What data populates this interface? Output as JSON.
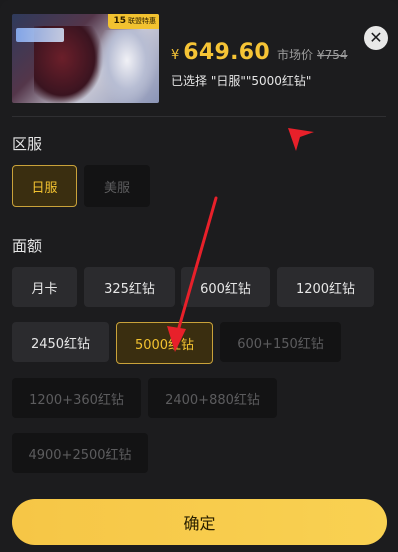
{
  "product": {
    "badge_number": "15",
    "badge_sub": "联盟特惠",
    "currency_symbol": "¥",
    "price": "649.60",
    "market_label": "市场价",
    "market_price": "¥754",
    "selected_text": "已选择 \"日服\"\"5000红钻\""
  },
  "server": {
    "title": "区服",
    "options": [
      {
        "label": "日服",
        "state": "selected"
      },
      {
        "label": "美服",
        "state": "disabled"
      }
    ]
  },
  "amount": {
    "title": "面额",
    "options": [
      {
        "label": "月卡",
        "state": "normal"
      },
      {
        "label": "325红钻",
        "state": "normal"
      },
      {
        "label": "600红钻",
        "state": "normal"
      },
      {
        "label": "1200红钻",
        "state": "normal"
      },
      {
        "label": "2450红钻",
        "state": "normal"
      },
      {
        "label": "5000红钻",
        "state": "selected"
      },
      {
        "label": "600+150红钻",
        "state": "disabled"
      },
      {
        "label": "1200+360红钻",
        "state": "disabled"
      },
      {
        "label": "2400+880红钻",
        "state": "disabled"
      },
      {
        "label": "4900+2500红钻",
        "state": "disabled"
      }
    ]
  },
  "confirm_label": "确定",
  "colors": {
    "accent": "#f6c436",
    "annotation": "#e8202a"
  },
  "icons": {
    "close": "close-icon"
  }
}
